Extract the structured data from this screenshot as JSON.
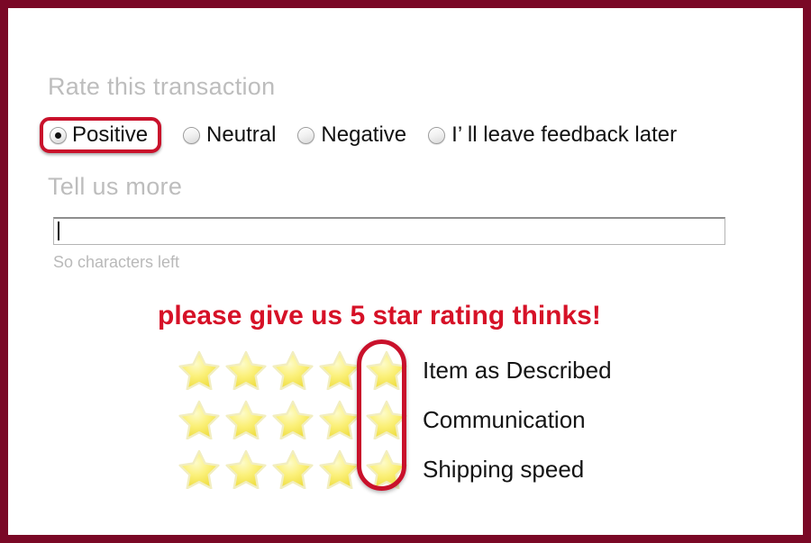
{
  "frame": {
    "border_color": "#7a0826",
    "background": "#ffffff"
  },
  "rate_section": {
    "heading": "Rate this transaction",
    "heading_color": "#bdbdbd",
    "options": [
      {
        "label": "Positive",
        "selected": true
      },
      {
        "label": "Neutral",
        "selected": false
      },
      {
        "label": "Negative",
        "selected": false
      },
      {
        "label": "I’ ll leave feedback later",
        "selected": false
      }
    ],
    "highlight_color": "#c9112b"
  },
  "tell_section": {
    "heading": "Tell us more",
    "input_value": "",
    "input_placeholder": "",
    "char_count": "So characters left"
  },
  "promo": {
    "text": "please give us 5 star rating thinks!",
    "color": "#d61127"
  },
  "ratings": {
    "star_count": 5,
    "star_color": "#f6ea5a",
    "highlighted_column": 5,
    "highlight_color": "#c9112b",
    "rows": [
      {
        "label": "Item as Described",
        "stars": 5
      },
      {
        "label": "Communication",
        "stars": 5
      },
      {
        "label": "Shipping speed",
        "stars": 5
      }
    ]
  }
}
